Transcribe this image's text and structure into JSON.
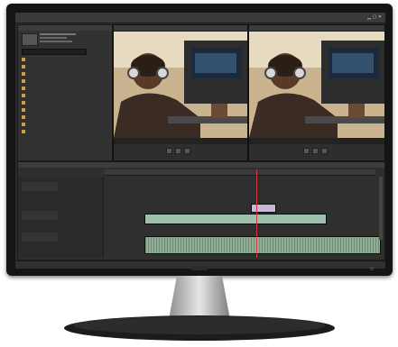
{
  "colors": {
    "ui_bg": "#2b2b2b",
    "timecode": "#e8a83a",
    "video_clip": "#7a9e8a",
    "audio_clip": "#8fae95",
    "playhead": "#d03a3a"
  },
  "icons": [
    "window-close-icon",
    "window-maximize-icon",
    "window-minimize-icon",
    "play-icon",
    "step-back-icon",
    "step-forward-icon",
    "folder-icon",
    "speaker-icon"
  ],
  "monitor_brand_logo": "logo",
  "power_button": "power-icon"
}
